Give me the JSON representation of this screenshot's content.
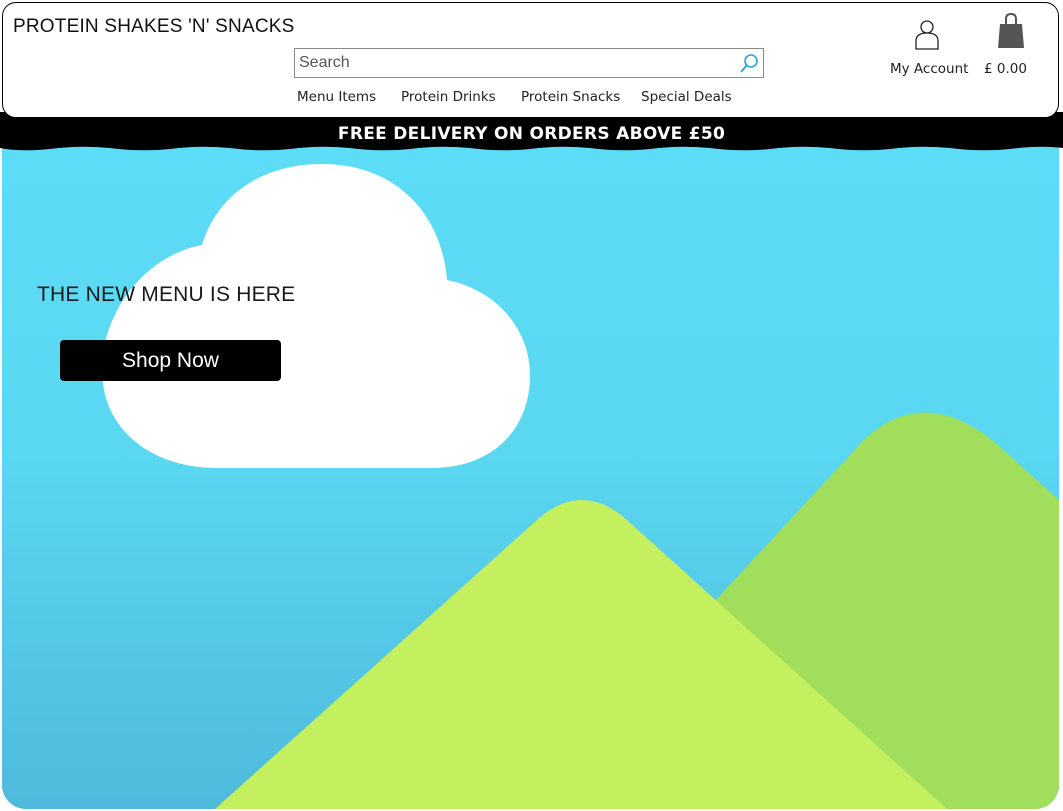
{
  "header": {
    "brand": "PROTEIN SHAKES 'N' SNACKS",
    "search": {
      "placeholder": "Search",
      "icon": "search-icon"
    },
    "nav": [
      {
        "label": "Menu Items"
      },
      {
        "label": "Protein Drinks"
      },
      {
        "label": "Protein Snacks"
      },
      {
        "label": "Special Deals"
      }
    ],
    "account": {
      "label": "My Account",
      "icon": "user-icon"
    },
    "cart": {
      "total": "£ 0.00",
      "icon": "shopping-bag-icon"
    }
  },
  "banner": {
    "text": "FREE DELIVERY ON ORDERS ABOVE £50"
  },
  "hero": {
    "title": "THE NEW MENU IS HERE",
    "cta": "Shop Now",
    "colors": {
      "sky_top": "#5ddcf7",
      "sky_bottom": "#4fbadb",
      "cloud": "#ffffff",
      "hill_front": "#c4f05f",
      "hill_back": "#a0de5c"
    }
  }
}
